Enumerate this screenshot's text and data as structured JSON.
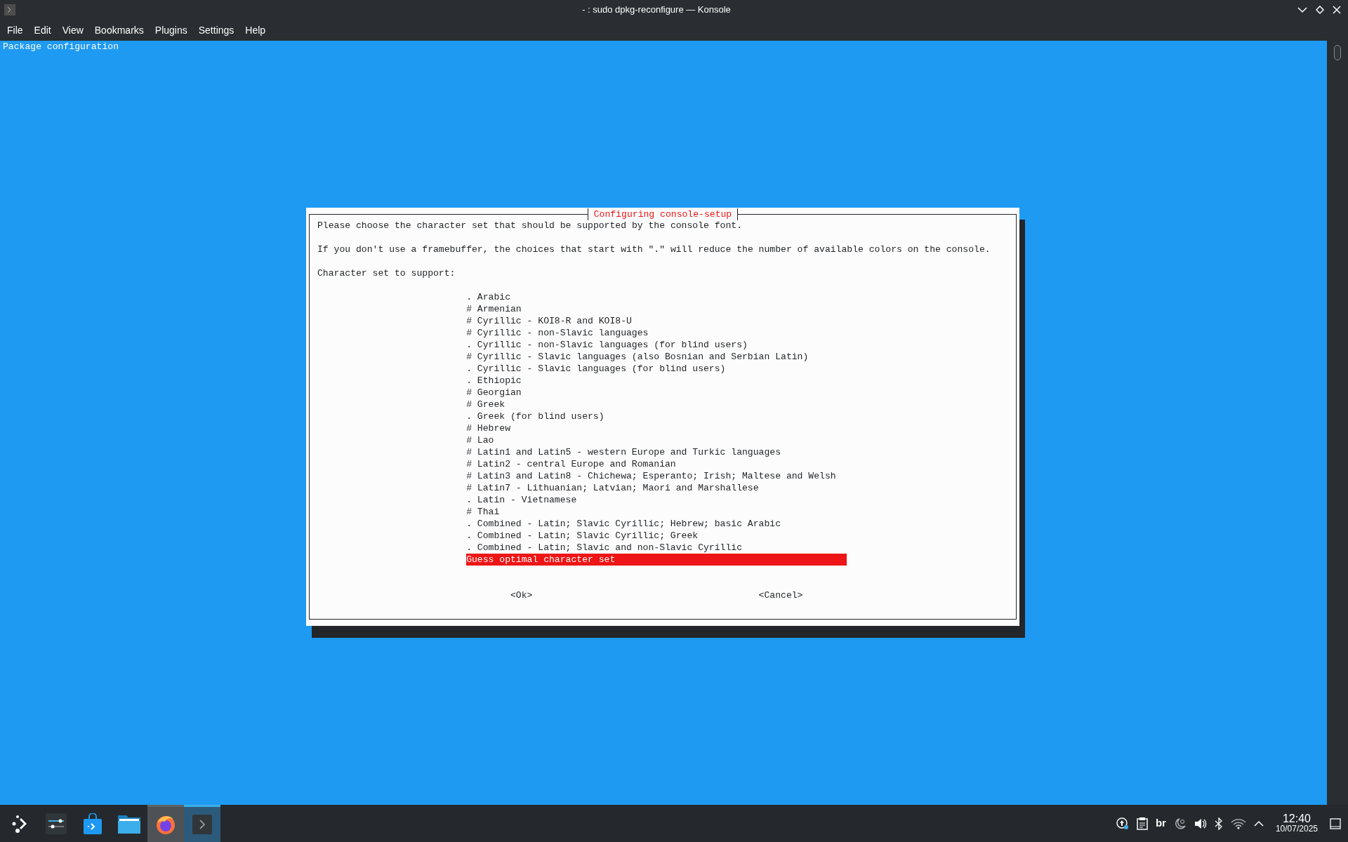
{
  "window": {
    "title": "- : sudo dpkg-reconfigure — Konsole"
  },
  "menu": [
    "File",
    "Edit",
    "View",
    "Bookmarks",
    "Plugins",
    "Settings",
    "Help"
  ],
  "terminal": {
    "header": "Package configuration",
    "dialog": {
      "title": "Configuring console-setup",
      "lines": [
        "Please choose the character set that should be supported by the console font.",
        "If you don't use a framebuffer, the choices that start with \".\" will reduce the number of available colors on the console.",
        "Character set to support:"
      ],
      "options": [
        {
          "label": ". Arabic",
          "selected": false
        },
        {
          "label": "# Armenian",
          "selected": false
        },
        {
          "label": "# Cyrillic - KOI8-R and KOI8-U",
          "selected": false
        },
        {
          "label": "# Cyrillic - non-Slavic languages",
          "selected": false
        },
        {
          "label": ". Cyrillic - non-Slavic languages (for blind users)",
          "selected": false
        },
        {
          "label": "# Cyrillic - Slavic languages (also Bosnian and Serbian Latin)",
          "selected": false
        },
        {
          "label": ". Cyrillic - Slavic languages (for blind users)",
          "selected": false
        },
        {
          "label": ". Ethiopic",
          "selected": false
        },
        {
          "label": "# Georgian",
          "selected": false
        },
        {
          "label": "# Greek",
          "selected": false
        },
        {
          "label": ". Greek (for blind users)",
          "selected": false
        },
        {
          "label": "# Hebrew",
          "selected": false
        },
        {
          "label": "# Lao",
          "selected": false
        },
        {
          "label": "# Latin1 and Latin5 - western Europe and Turkic languages",
          "selected": false
        },
        {
          "label": "# Latin2 - central Europe and Romanian",
          "selected": false
        },
        {
          "label": "# Latin3 and Latin8 - Chichewa; Esperanto; Irish; Maltese and Welsh",
          "selected": false
        },
        {
          "label": "# Latin7 - Lithuanian; Latvian; Maori and Marshallese",
          "selected": false
        },
        {
          "label": ". Latin - Vietnamese",
          "selected": false
        },
        {
          "label": "# Thai",
          "selected": false
        },
        {
          "label": ". Combined - Latin; Slavic Cyrillic; Hebrew; basic Arabic",
          "selected": false
        },
        {
          "label": ". Combined - Latin; Slavic Cyrillic; Greek",
          "selected": false
        },
        {
          "label": ". Combined - Latin; Slavic and non-Slavic Cyrillic",
          "selected": false
        },
        {
          "label": "Guess optimal character set",
          "selected": true
        }
      ],
      "buttons": [
        "<Ok>",
        "<Cancel>"
      ]
    }
  },
  "taskbar": {
    "apps": [
      {
        "kind": "launcher",
        "selected": false,
        "hovered": false
      },
      {
        "kind": "settings",
        "selected": false,
        "hovered": false
      },
      {
        "kind": "store",
        "selected": false,
        "hovered": false
      },
      {
        "kind": "files",
        "selected": false,
        "hovered": false
      },
      {
        "kind": "browser",
        "selected": false,
        "hovered": true
      },
      {
        "kind": "terminal",
        "selected": true,
        "hovered": false
      }
    ],
    "keyboard_layout": "br",
    "time": "12:40",
    "date": "10/07/2025"
  }
}
